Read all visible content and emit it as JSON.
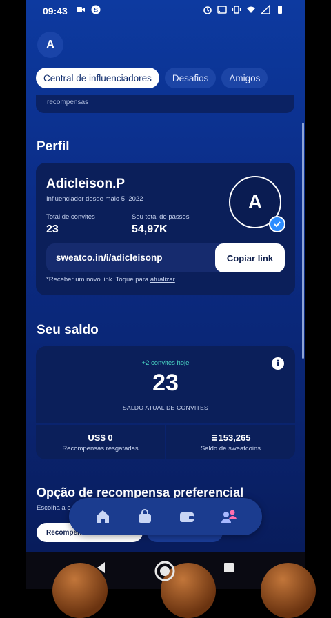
{
  "status_bar": {
    "time": "09:43"
  },
  "header": {
    "avatar_initial": "A"
  },
  "tabs": [
    {
      "label": "Central de influenciadores",
      "active": true
    },
    {
      "label": "Desafios",
      "active": false
    },
    {
      "label": "Amigos",
      "active": false
    }
  ],
  "previous_card": {
    "text": "recompensas"
  },
  "profile": {
    "section_title": "Perfil",
    "name": "Adicleison.P",
    "since": "Influenciador desde maio 5, 2022",
    "avatar_initial": "A",
    "stats": [
      {
        "label": "Total de convites",
        "value": "23"
      },
      {
        "label": "Seu total de passos",
        "value": "54,97K"
      }
    ],
    "link": "sweatco.in/i/adicleisonp",
    "copy_label": "Copiar link",
    "note_prefix": "*Receber um novo link. Toque para ",
    "note_link": "atualizar"
  },
  "balance": {
    "section_title": "Seu saldo",
    "today": "+2 convites hoje",
    "value": "23",
    "label": "SALDO ATUAL DE CONVITES",
    "rewards_value": "US$ 0",
    "rewards_label": "Recompensas resgatadas",
    "sweatcoins_value": "153,265",
    "sweatcoins_label": "Saldo de sweatcoins"
  },
  "reward_option": {
    "title": "Opção de recompensa preferencial",
    "subtitle": "Escolha a c",
    "pill_label": "Recompen"
  },
  "bottom_nav": [
    "home-icon",
    "shop-bag-icon",
    "wallet-icon",
    "friends-icon"
  ],
  "colors": {
    "accent": "#49d3c2",
    "bg_top": "#0d3aa0",
    "card": "#0b1f5a",
    "check": "#2d8cff"
  }
}
